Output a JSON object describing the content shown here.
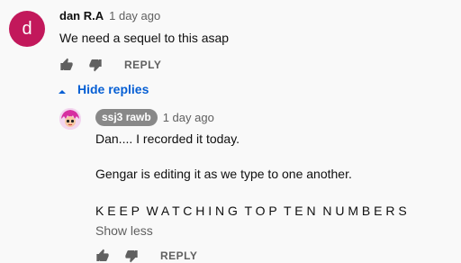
{
  "comment": {
    "avatar_letter": "d",
    "author": "dan R.A",
    "time": "1 day ago",
    "text": "We need a sequel to this asap",
    "reply_label": "REPLY",
    "hide_replies_label": "Hide replies",
    "colors": {
      "avatar_bg": "#c2185b",
      "link_blue": "#065fd4"
    }
  },
  "reply": {
    "author": "ssj3 rawb",
    "time": "1 day ago",
    "lines": [
      "Dan.... I recorded it today.",
      "Gengar is editing it as we type to one another.",
      "K E E P  W A T C H I N G  T O P  T E N  N U M B E R S"
    ],
    "show_less_label": "Show less",
    "reply_label": "REPLY",
    "colors": {
      "badge_bg": "#888888"
    }
  },
  "icons": [
    "thumb-up-icon",
    "thumb-down-icon",
    "caret-up-icon"
  ]
}
